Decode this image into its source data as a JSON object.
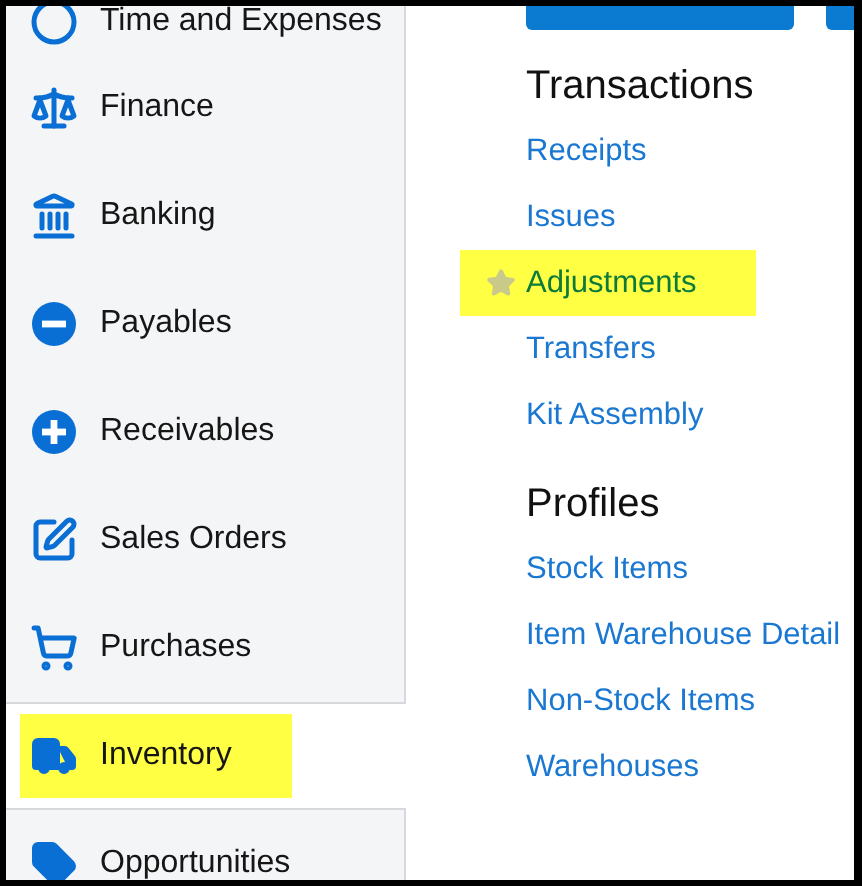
{
  "sidebar": {
    "items": [
      {
        "label": "Time and Expenses",
        "selected": false,
        "highlighted": false
      },
      {
        "label": "Finance",
        "selected": false,
        "highlighted": false
      },
      {
        "label": "Banking",
        "selected": false,
        "highlighted": false
      },
      {
        "label": "Payables",
        "selected": false,
        "highlighted": false
      },
      {
        "label": "Receivables",
        "selected": false,
        "highlighted": false
      },
      {
        "label": "Sales Orders",
        "selected": false,
        "highlighted": false
      },
      {
        "label": "Purchases",
        "selected": false,
        "highlighted": false
      },
      {
        "label": "Inventory",
        "selected": true,
        "highlighted": true
      },
      {
        "label": "Opportunities",
        "selected": false,
        "highlighted": false
      }
    ]
  },
  "sections": [
    {
      "title": "Transactions",
      "links": [
        {
          "label": "Receipts",
          "highlighted": false,
          "starred": false
        },
        {
          "label": "Issues",
          "highlighted": false,
          "starred": false
        },
        {
          "label": "Adjustments",
          "highlighted": true,
          "starred": true
        },
        {
          "label": "Transfers",
          "highlighted": false,
          "starred": false
        },
        {
          "label": "Kit Assembly",
          "highlighted": false,
          "starred": false
        }
      ]
    },
    {
      "title": "Profiles",
      "links": [
        {
          "label": "Stock Items",
          "highlighted": false,
          "starred": false
        },
        {
          "label": "Item Warehouse Detail",
          "highlighted": false,
          "starred": false
        },
        {
          "label": "Non-Stock Items",
          "highlighted": false,
          "starred": false
        },
        {
          "label": "Warehouses",
          "highlighted": false,
          "starred": false
        }
      ]
    }
  ]
}
